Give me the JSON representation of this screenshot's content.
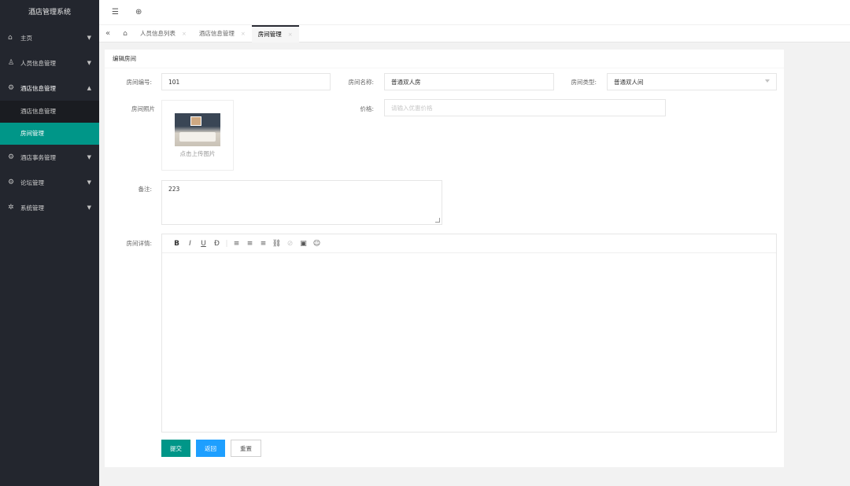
{
  "app": {
    "title": "酒店管理系统"
  },
  "sidebar": {
    "items": [
      {
        "label": "主页",
        "icon": "home-icon"
      },
      {
        "label": "人员信息管理",
        "icon": "user-icon"
      },
      {
        "label": "酒店信息管理",
        "icon": "settings-icon",
        "children": [
          {
            "label": "酒店信息管理"
          },
          {
            "label": "房间管理"
          }
        ]
      },
      {
        "label": "酒店事务管理",
        "icon": "settings-icon"
      },
      {
        "label": "论坛管理",
        "icon": "settings-icon"
      },
      {
        "label": "系统管理",
        "icon": "gear-icon"
      }
    ]
  },
  "tabs": [
    {
      "label": "人员信息列表"
    },
    {
      "label": "酒店信息管理"
    },
    {
      "label": "房间管理"
    }
  ],
  "form": {
    "title": "编辑房间",
    "room_no_label": "房间编号:",
    "room_no_value": "101",
    "room_name_label": "房间名称:",
    "room_name_value": "普通双人房",
    "room_type_label": "房间类型:",
    "room_type_value": "普通双人间",
    "photo_label": "房间照片",
    "upload_text": "点击上传图片",
    "price_label": "价格:",
    "price_placeholder": "请输入优惠价格",
    "remark_label": "备注:",
    "remark_value": "223",
    "detail_label": "房间详情:"
  },
  "buttons": {
    "submit": "提交",
    "back": "返回",
    "reset": "重置"
  },
  "colors": {
    "sidebar_bg": "#23262e",
    "active": "#009688",
    "primary_blue": "#1e9fff"
  }
}
